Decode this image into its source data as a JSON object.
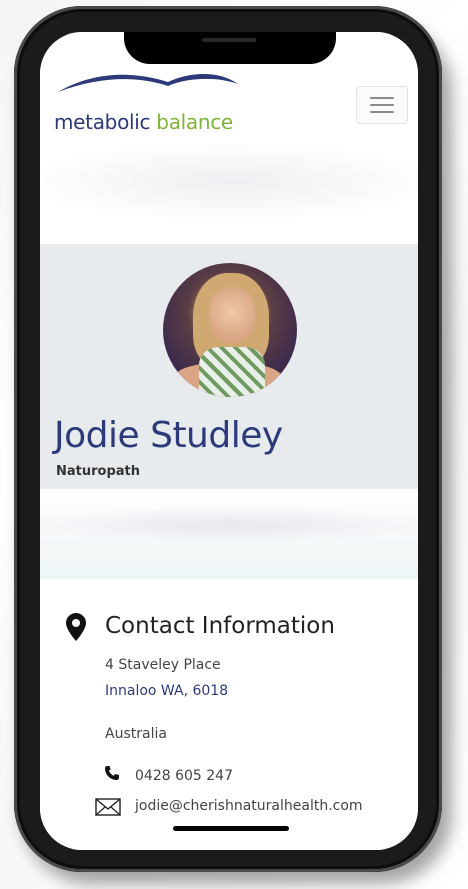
{
  "header": {
    "logo": {
      "word1": "metabolic",
      "word2": "balance"
    },
    "menu_button": "menu"
  },
  "profile": {
    "name": "Jodie Studley",
    "role": "Naturopath"
  },
  "contact": {
    "title": "Contact Information",
    "address_line1": "4 Staveley Place",
    "address_line2": "Innaloo WA, 6018",
    "country": "Australia",
    "phone": "0428 605 247",
    "email": "jodie@cherishnaturalhealth.com"
  },
  "colors": {
    "brand_blue": "#2d3a7a",
    "brand_green": "#7fb43a",
    "profile_bg": "#e7ebee"
  },
  "icons": [
    "location-pin-icon",
    "phone-icon",
    "envelope-icon",
    "hamburger-menu-icon"
  ]
}
